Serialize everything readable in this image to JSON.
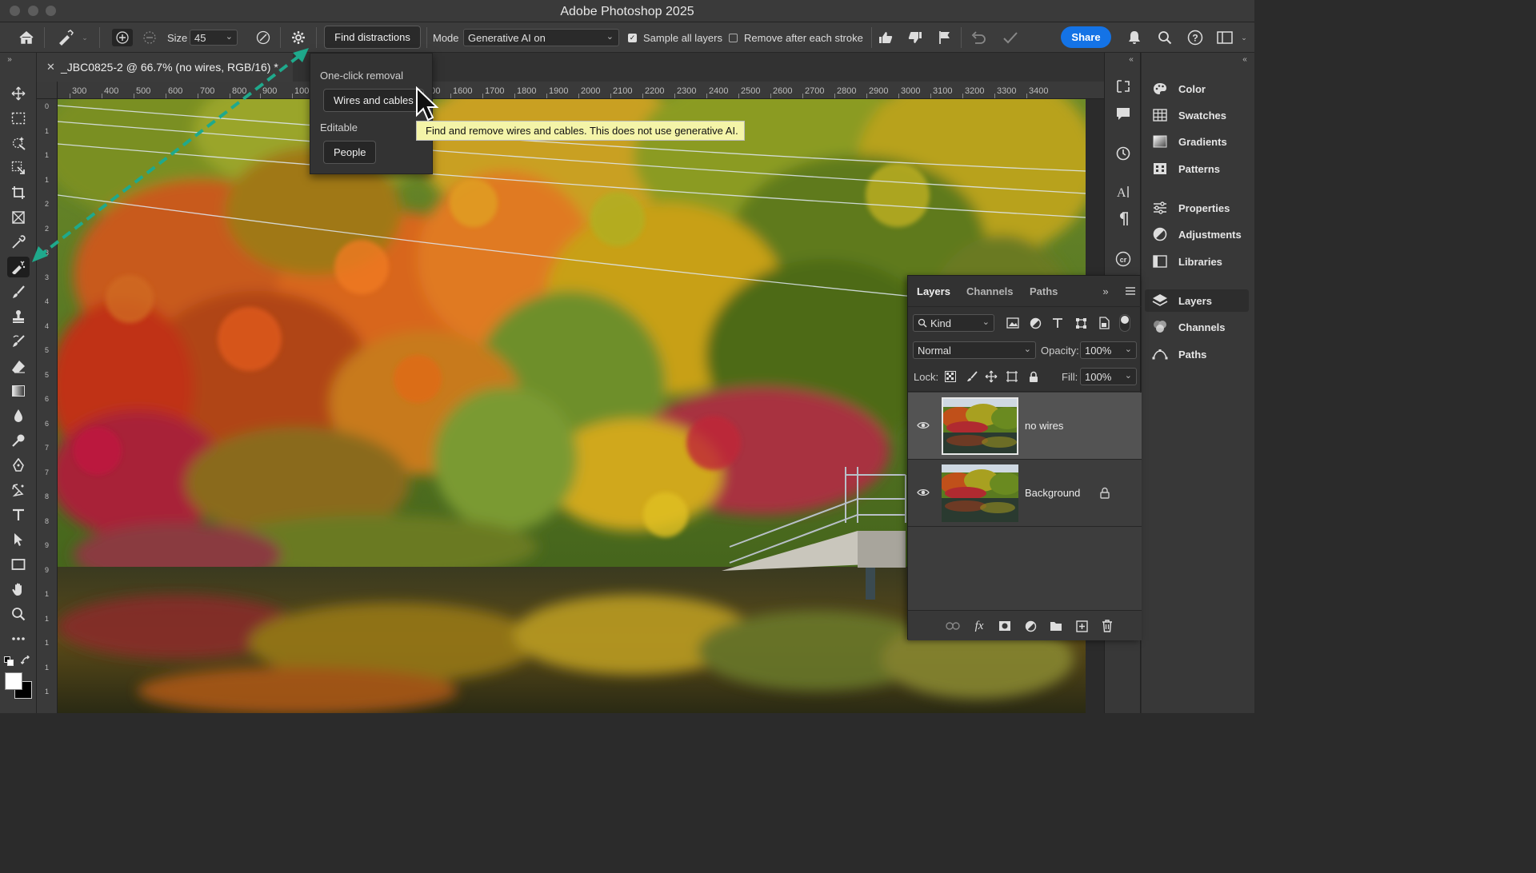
{
  "window": {
    "title": "Adobe Photoshop 2025"
  },
  "options_bar": {
    "size_label": "Size",
    "size_value": "45",
    "find_distractions_label": "Find distractions",
    "mode_label": "Mode",
    "mode_value": "Generative AI on",
    "sample_all_layers_label": "Sample all layers",
    "sample_all_layers_checked": true,
    "remove_after_stroke_label": "Remove after each stroke",
    "remove_after_stroke_checked": false,
    "share_label": "Share"
  },
  "document": {
    "tab_title": "_JBC0825-2 @ 66.7% (no wires, RGB/16) *",
    "ruler_h": [
      "300",
      "400",
      "500",
      "600",
      "700",
      "800",
      "900",
      "100",
      "1500",
      "1600",
      "1700",
      "1800",
      "1900",
      "2000",
      "2100",
      "2200",
      "2300",
      "2400",
      "2500",
      "2600",
      "2700",
      "2800",
      "2900",
      "3000",
      "3100",
      "3200",
      "3300",
      "3400"
    ],
    "ruler_v": [
      "0",
      "1",
      "1",
      "1",
      "2",
      "2",
      "3",
      "3",
      "4",
      "4",
      "5",
      "5",
      "6",
      "6",
      "7",
      "7",
      "8",
      "8",
      "9",
      "9",
      "1",
      "1",
      "1",
      "1",
      "1"
    ]
  },
  "distractions_menu": {
    "section1": "One-click removal",
    "wires_button": "Wires and cables",
    "section2": "Editable",
    "people_button": "People",
    "tooltip": "Find and remove wires and cables. This does not use generative AI."
  },
  "right_panels": {
    "items": [
      {
        "label": "Color",
        "icon": "color-icon"
      },
      {
        "label": "Swatches",
        "icon": "swatches-icon"
      },
      {
        "label": "Gradients",
        "icon": "gradients-icon"
      },
      {
        "label": "Patterns",
        "icon": "patterns-icon"
      },
      {
        "label": "Properties",
        "icon": "properties-icon"
      },
      {
        "label": "Adjustments",
        "icon": "adjustments-icon"
      },
      {
        "label": "Libraries",
        "icon": "libraries-icon"
      },
      {
        "label": "Layers",
        "icon": "layers-icon"
      },
      {
        "label": "Channels",
        "icon": "channels-icon"
      },
      {
        "label": "Paths",
        "icon": "paths-icon"
      }
    ]
  },
  "layers_panel": {
    "tabs": [
      "Layers",
      "Channels",
      "Paths"
    ],
    "filter_kind": "Kind",
    "blend_mode": "Normal",
    "opacity_label": "Opacity:",
    "opacity_value": "100%",
    "lock_label": "Lock:",
    "fill_label": "Fill:",
    "fill_value": "100%",
    "layers": [
      {
        "name": "no wires",
        "visible": true,
        "locked": false,
        "selected": true
      },
      {
        "name": "Background",
        "visible": true,
        "locked": true,
        "selected": false
      }
    ]
  },
  "colors": {
    "accent": "#1473e6",
    "annotation_arrow": "#1fa98c",
    "tooltip_bg": "#f4f4a8"
  }
}
